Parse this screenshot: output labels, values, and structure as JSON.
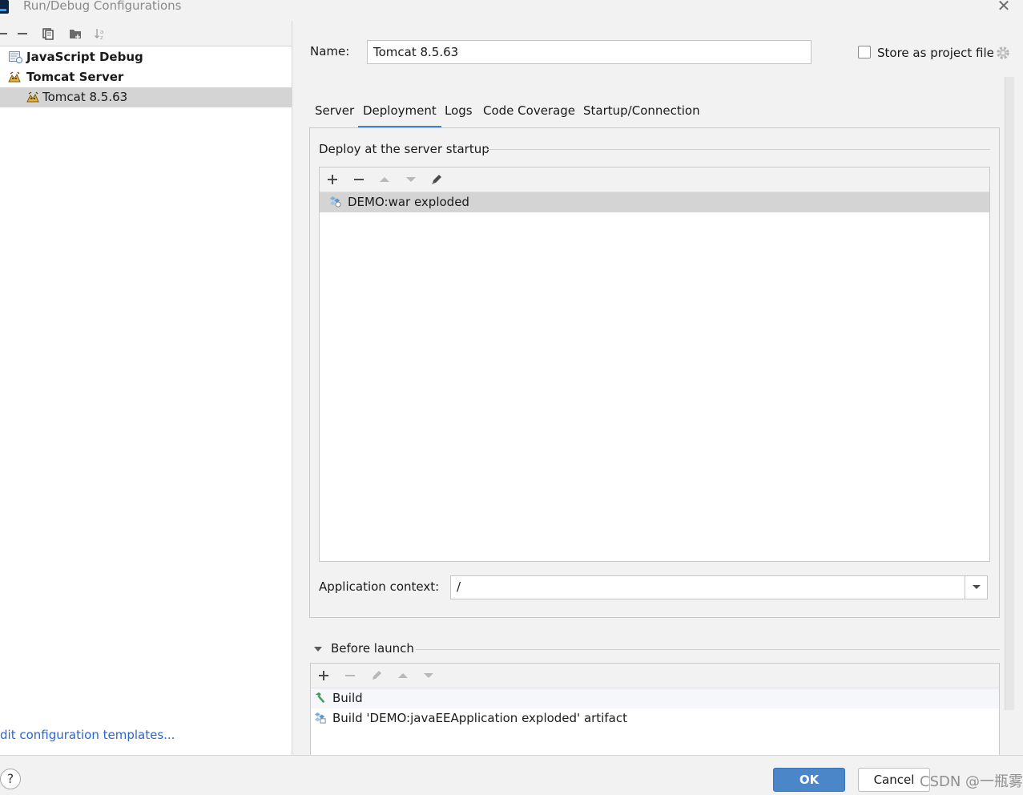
{
  "window": {
    "title": "Run/Debug Configurations",
    "close_glyph": "✕"
  },
  "left_toolbar": {
    "icons": [
      "add-icon",
      "remove-icon",
      "copy-icon",
      "folder-icon",
      "sort-icon"
    ]
  },
  "tree": {
    "items": [
      {
        "label": "JavaScript Debug",
        "icon": "javascript-debug-icon",
        "level": 0,
        "bold": true
      },
      {
        "label": "Tomcat Server",
        "icon": "tomcat-icon",
        "level": 0,
        "bold": true
      },
      {
        "label": "Tomcat 8.5.63",
        "icon": "tomcat-icon",
        "level": 1,
        "selected": true
      }
    ]
  },
  "edit_templates_link": "dit configuration templates...",
  "config": {
    "name_label": "Name:",
    "name_value": "Tomcat 8.5.63",
    "store_label": "Store as project file",
    "store_checked": false
  },
  "tabs": [
    "Server",
    "Deployment",
    "Logs",
    "Code Coverage",
    "Startup/Connection"
  ],
  "active_tab": "Deployment",
  "deployment": {
    "section_title": "Deploy at the server startup",
    "toolbar_icons": [
      "add-icon",
      "remove-icon",
      "move-up-icon",
      "move-down-icon",
      "edit-icon"
    ],
    "artifacts": [
      "DEMO:war exploded"
    ],
    "context_label": "Application context:",
    "context_value": "/"
  },
  "before_launch": {
    "title": "Before launch",
    "toolbar_icons": [
      "add-icon",
      "remove-icon",
      "edit-icon",
      "move-up-icon",
      "move-down-icon"
    ],
    "items": [
      {
        "label": "Build",
        "icon": "build-hammer-icon"
      },
      {
        "label": "Build 'DEMO:javaEEApplication exploded' artifact",
        "icon": "artifact-icon"
      }
    ]
  },
  "buttons": {
    "help": "?",
    "ok": "OK",
    "cancel": "Cancel"
  },
  "watermark": "CSDN @一瓶雾汽水",
  "colors": {
    "accent": "#4083c9",
    "ok_button": "#4a86c8",
    "link": "#2f65ca",
    "selection": "#d4d4d4"
  }
}
